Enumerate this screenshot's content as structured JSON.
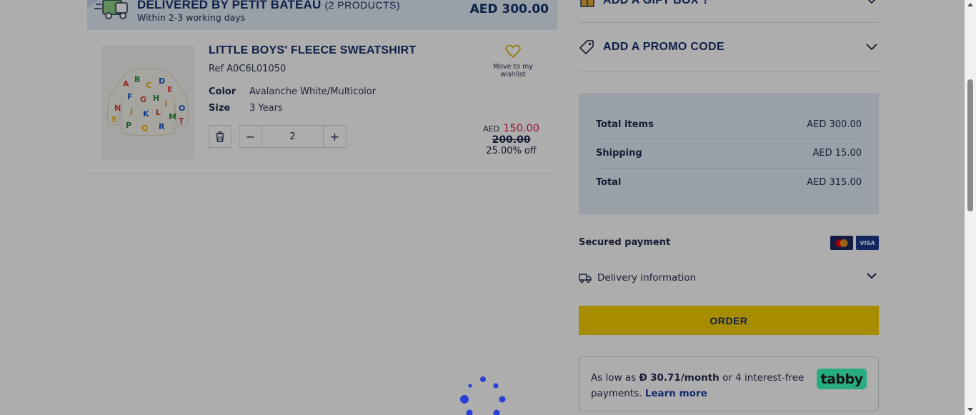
{
  "delivery": {
    "title": "DELIVERED BY PETIT BATEAU",
    "count": "(2 PRODUCTS)",
    "subtitle": "Within 2-3 working days",
    "total": "AED 300.00"
  },
  "item": {
    "name": "LITTLE BOYS' FLEECE SWEATSHIRT",
    "ref": "Ref A0C6L01050",
    "color_label": "Color",
    "color_value": "Avalanche White/Multicolor",
    "size_label": "Size",
    "size_value": "3 Years",
    "quantity": "2",
    "qty_minus": "−",
    "qty_plus": "+",
    "wishlist_label": "Move to my wishlist",
    "price_currency": "AED",
    "price_sale": "150.00",
    "price_old": "200.00",
    "price_discount": "25.00% off"
  },
  "sidebar": {
    "gift_box": "ADD A GIFT BOX ?",
    "promo_code": "ADD A PROMO CODE",
    "summary": {
      "items_label": "Total items",
      "items_value": "AED 300.00",
      "shipping_label": "Shipping",
      "shipping_value": "AED 15.00",
      "total_label": "Total",
      "total_value": "AED 315.00"
    },
    "secured_payment": "Secured payment",
    "visa": "VISA",
    "delivery_info": "Delivery information",
    "order_button": "ORDER",
    "tabby": {
      "prefix": "As low as",
      "currency_symbol": "Đ",
      "amount": "30.71/month",
      "suffix": "or 4 interest-free payments.",
      "link": "Learn more",
      "logo": "tabby"
    }
  },
  "colors": {
    "brand_navy": "#14306b",
    "order_yellow": "#f6cf00",
    "sale_red": "#e0203a",
    "summary_bg": "#e3ecf6",
    "tabby_green": "#3bffc1",
    "spinner_blue": "#2a3fd6"
  },
  "icons": [
    "truck-icon",
    "heart-icon",
    "trash-icon",
    "gift-icon",
    "tag-icon",
    "chevron-down-icon",
    "delivery-truck-icon",
    "mastercard-icon",
    "visa-icon",
    "loading-spinner-icon"
  ]
}
